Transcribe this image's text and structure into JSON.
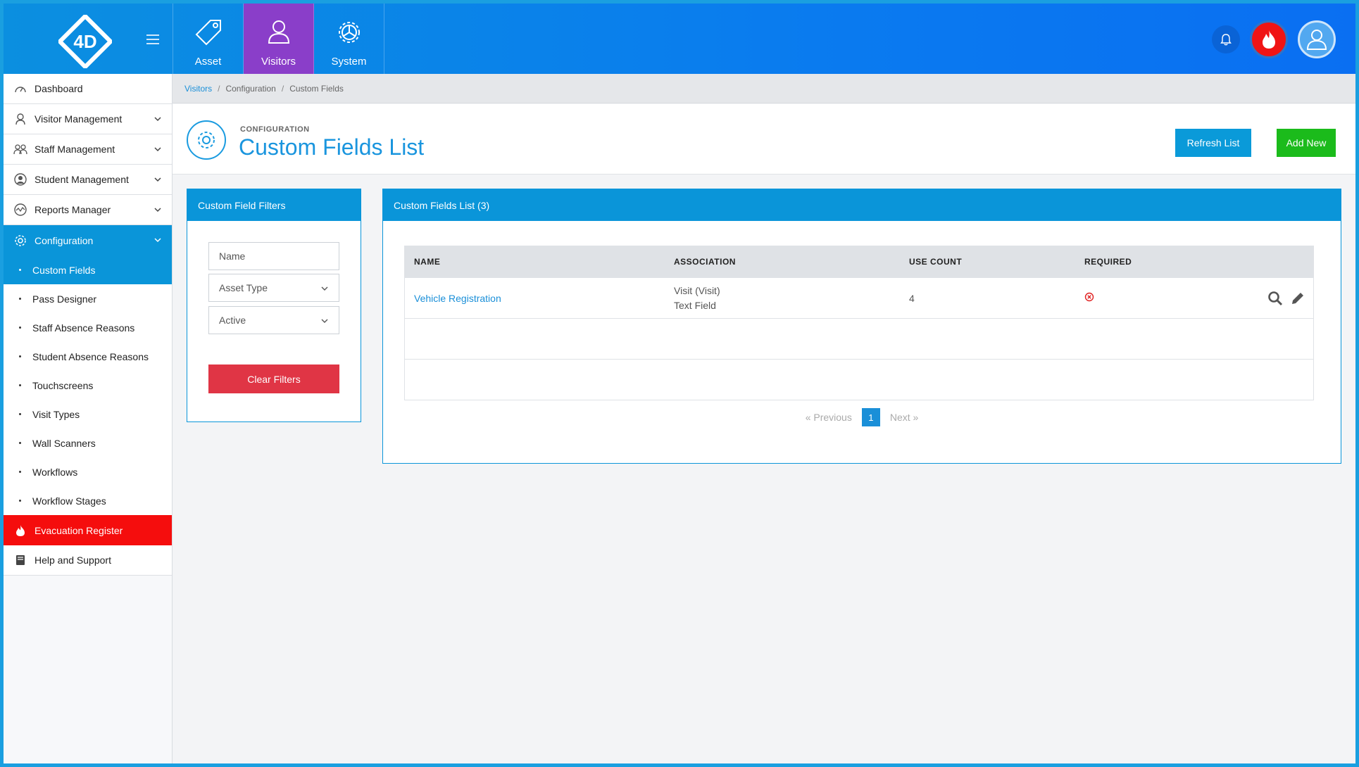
{
  "topnav": {
    "logo_text": "4D",
    "modules": [
      {
        "label": "Asset"
      },
      {
        "label": "Visitors"
      },
      {
        "label": "System"
      }
    ]
  },
  "sidebar": {
    "items": [
      {
        "label": "Dashboard"
      },
      {
        "label": "Visitor Management"
      },
      {
        "label": "Staff Management"
      },
      {
        "label": "Student Management"
      },
      {
        "label": "Reports Manager"
      },
      {
        "label": "Configuration"
      }
    ],
    "config_sub": [
      {
        "label": "Custom Fields"
      },
      {
        "label": "Pass Designer"
      },
      {
        "label": "Staff Absence Reasons"
      },
      {
        "label": "Student Absence Reasons"
      },
      {
        "label": "Touchscreens"
      },
      {
        "label": "Visit Types"
      },
      {
        "label": "Wall Scanners"
      },
      {
        "label": "Workflows"
      },
      {
        "label": "Workflow Stages"
      }
    ],
    "evacuation": {
      "label": "Evacuation Register"
    },
    "help": {
      "label": "Help and Support"
    }
  },
  "breadcrumb": [
    "Visitors",
    "Configuration",
    "Custom Fields"
  ],
  "header": {
    "subtitle": "CONFIGURATION",
    "title": "Custom Fields List",
    "refresh_label": "Refresh List",
    "add_label": "Add New"
  },
  "filters": {
    "title": "Custom Field Filters",
    "name_placeholder": "Name",
    "asset_type": "Asset Type",
    "status": "Active",
    "clear_label": "Clear Filters"
  },
  "list": {
    "title": "Custom Fields List (3)",
    "columns": [
      "NAME",
      "ASSOCIATION",
      "USE COUNT",
      "REQUIRED"
    ],
    "rows": [
      {
        "name": "Vehicle Registration",
        "association_1": "Visit (Visit)",
        "association_2": "Text Field",
        "use_count": "4",
        "required": "no"
      }
    ]
  },
  "pager": {
    "prev": "« Previous",
    "page": "1",
    "next": "Next »"
  },
  "colors": {
    "primary": "#0a95d9",
    "visitors_active": "#8a3ec9",
    "evacuation": "#f50d0d",
    "add_button": "#1bbb1b",
    "clear_button": "#e03545"
  }
}
